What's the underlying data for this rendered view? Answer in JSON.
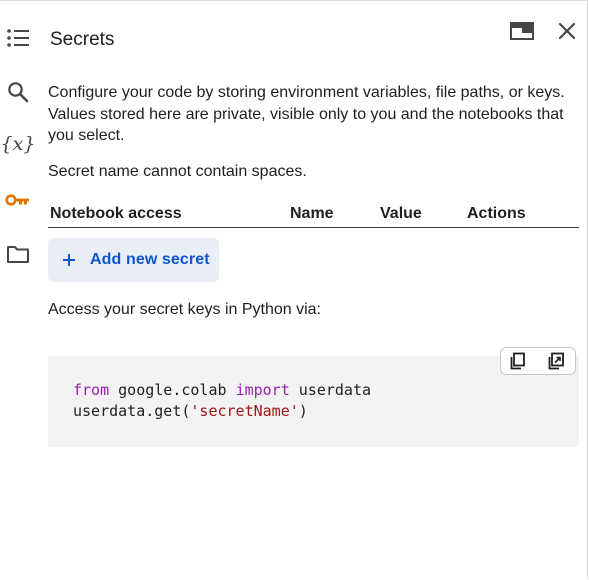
{
  "panel": {
    "title": "Secrets",
    "description": "Configure your code by storing environment variables, file paths, or keys. Values stored here are private, visible only to you and the notebooks that you select.",
    "hint": "Secret name cannot contain spaces."
  },
  "rail": {
    "items": [
      {
        "icon": "table-of-contents-icon"
      },
      {
        "icon": "search-icon"
      },
      {
        "icon": "variables-icon",
        "label": "{x}"
      },
      {
        "icon": "key-icon",
        "active_color": "#e37400"
      },
      {
        "icon": "folder-icon"
      }
    ]
  },
  "header_buttons": {
    "dock": "dock-icon",
    "close": "close-icon"
  },
  "table": {
    "columns": [
      "Notebook access",
      "Name",
      "Value",
      "Actions"
    ]
  },
  "add_secret": {
    "label": "Add new secret"
  },
  "access_text": "Access your secret keys in Python via:",
  "code": {
    "line1": {
      "kw1": "from",
      "module": " google.colab ",
      "kw2": "import",
      "name": " userdata"
    },
    "line2": {
      "call": "userdata.get(",
      "str": "'secretName'",
      "close": ")"
    }
  },
  "colors": {
    "accent": "#0b57d0",
    "button_bg": "#e9eef6",
    "keyword": "#9b1fb2",
    "string": "#a31515",
    "key_icon": "#e37400"
  }
}
